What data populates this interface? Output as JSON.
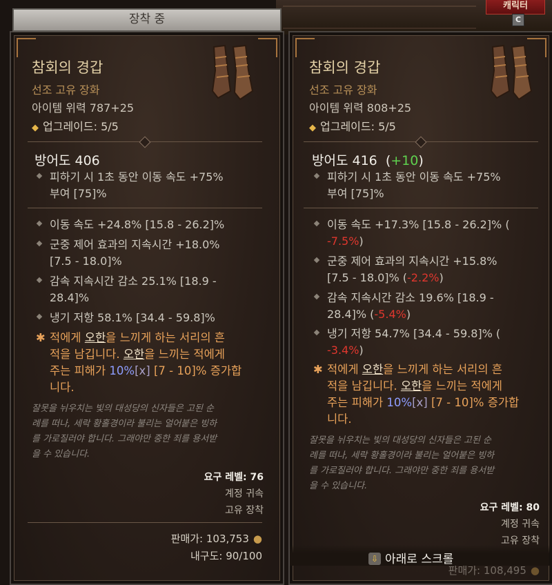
{
  "header": {
    "equipped_label": "장착 중",
    "character_tab": "캐릭터",
    "character_key": "C"
  },
  "left": {
    "name": "참회의 경갑",
    "type": "선조 고유 장화",
    "power": "아이템 위력 787+25",
    "upgrade": "업그레이드: 5/5",
    "armor": "방어도 406",
    "implicit_1": "피하기 시 1초 동안 이동 속도 +75%",
    "implicit_2": "부여 [75]%",
    "affixes": [
      {
        "l1": "이동 속도 +24.8% [15.8 - 26.2]%",
        "l2": ""
      },
      {
        "l1": "군중 제어 효과의 지속시간 +18.0%",
        "l2": "[7.5 - 18.0]%"
      },
      {
        "l1": "감속 지속시간 감소 25.1% [18.9 -",
        "l2": "28.4]%"
      },
      {
        "l1": "냉기 저항 58.1% [34.4 - 59.8]%",
        "l2": ""
      }
    ],
    "unique": {
      "l1a": "적에게 ",
      "l1u": "오한",
      "l1b": "을 느끼게 하는 서리의 흔",
      "l2a": "적을 남깁니다. ",
      "l2u": "오한",
      "l2b": "을 느끼는 적에게",
      "l3a": "주는 피해가 ",
      "l3blue": "10%",
      "l3x": "[x]",
      "l3b": " [7 - 10]% 증가합",
      "l4": "니다."
    },
    "flavor": [
      "잘못을 뉘우치는 빛의 대성당의 신자들은 고된 순",
      "례를 떠나, 세락 황홀경이라 불리는 얼어붙은 빙하",
      "를 가로질러야 합니다. 그래야만 중한 죄를 용서받",
      "을 수 있습니다."
    ],
    "required_level": "요구 레벨: 76",
    "account_bound": "계정 귀속",
    "unique_equipped": "고유 장착",
    "sell": "판매가: 103,753",
    "durability": "내구도: 90/100"
  },
  "right": {
    "name": "참회의 경갑",
    "type": "선조 고유 장화",
    "power": "아이템 위력 808+25",
    "upgrade": "업그레이드: 5/5",
    "armor": "방어도 416",
    "armor_delta": "+10",
    "implicit_1": "피하기 시 1초 동안 이동 속도 +75%",
    "implicit_2": "부여 [75]%",
    "affixes": [
      {
        "l1": "이동 속도 +17.3% [15.8 - 26.2]% (",
        "l2a": "",
        "l2neg": "-7.5%",
        "l2b": ")"
      },
      {
        "l1": "군중 제어 효과의 지속시간 +15.8%",
        "l2a": "[7.5 - 18.0]% (",
        "l2neg": "-2.2%",
        "l2b": ")"
      },
      {
        "l1": "감속 지속시간 감소 19.6% [18.9 -",
        "l2a": "28.4]% (",
        "l2neg": "-5.4%",
        "l2b": ")"
      },
      {
        "l1": "냉기 저항 54.7% [34.4 - 59.8]% (",
        "l2a": "",
        "l2neg": "-3.4%",
        "l2b": ")"
      }
    ],
    "unique": {
      "l1a": "적에게 ",
      "l1u": "오한",
      "l1b": "을 느끼게 하는 서리의 흔",
      "l2a": "적을 남깁니다. ",
      "l2u": "오한",
      "l2b": "을 느끼는 적에게",
      "l3a": "주는 피해가 ",
      "l3blue": "10%",
      "l3x": "[x]",
      "l3b": " [7 - 10]% 증가합",
      "l4": "니다."
    },
    "flavor": [
      "잘못을 뉘우치는 빛의 대성당의 신자들은 고된 순",
      "례를 떠나, 세락 황홀경이라 불리는 얼어붙은 빙하",
      "를 가로질러야 합니다. 그래야만 중한 죄를 용서받",
      "을 수 있습니다."
    ],
    "required_level": "요구 레벨: 80",
    "account_bound": "계정 귀속",
    "unique_equipped": "고유 장착",
    "sell": "판매가: 108,495"
  },
  "scroll_hint": "아래로 스크롤",
  "colors": {
    "unique_orange": "#e8a25a",
    "negative_red": "#e0372e",
    "positive_green": "#5fd24f",
    "highlight_blue": "#8e9dff"
  }
}
